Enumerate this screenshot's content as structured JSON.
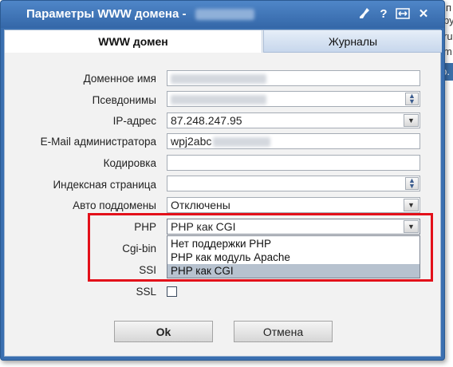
{
  "background": {
    "right_letters": [
      "п",
      "ру",
      "ru",
      "m.",
      "о."
    ]
  },
  "dialog": {
    "title": "Параметры WWW домена -",
    "icons": [
      "broom-icon",
      "help-icon",
      "resize-icon",
      "close-icon"
    ],
    "help_symbol": "?",
    "close_symbol": "✕"
  },
  "tabs": [
    {
      "label": "WWW домен",
      "active": true
    },
    {
      "label": "Журналы",
      "active": false
    }
  ],
  "form": {
    "domain_label": "Доменное имя",
    "aliases_label": "Псевдонимы",
    "ip_label": "IP-адрес",
    "ip_value": "87.248.247.95",
    "email_label": "E-Mail администратора",
    "email_value": "wpj2abc",
    "encoding_label": "Кодировка",
    "index_label": "Индексная страница",
    "autosub_label": "Авто поддомены",
    "autosub_value": "Отключены",
    "php_label": "PHP",
    "php_value": "PHP как CGI",
    "cgibin_label": "Cgi-bin",
    "ssi_label": "SSI",
    "ssl_label": "SSL",
    "ssl_checked": false
  },
  "php_options": [
    {
      "label": "Нет поддержки PHP",
      "selected": false
    },
    {
      "label": "PHP как модуль Apache",
      "selected": false
    },
    {
      "label": "PHP как CGI",
      "selected": true
    }
  ],
  "buttons": {
    "ok": "Ok",
    "cancel": "Отмена"
  },
  "colors": {
    "titlebar": "#3a6fb0",
    "highlight_border": "#e3101a",
    "selected_option": "#b7c2cf"
  }
}
